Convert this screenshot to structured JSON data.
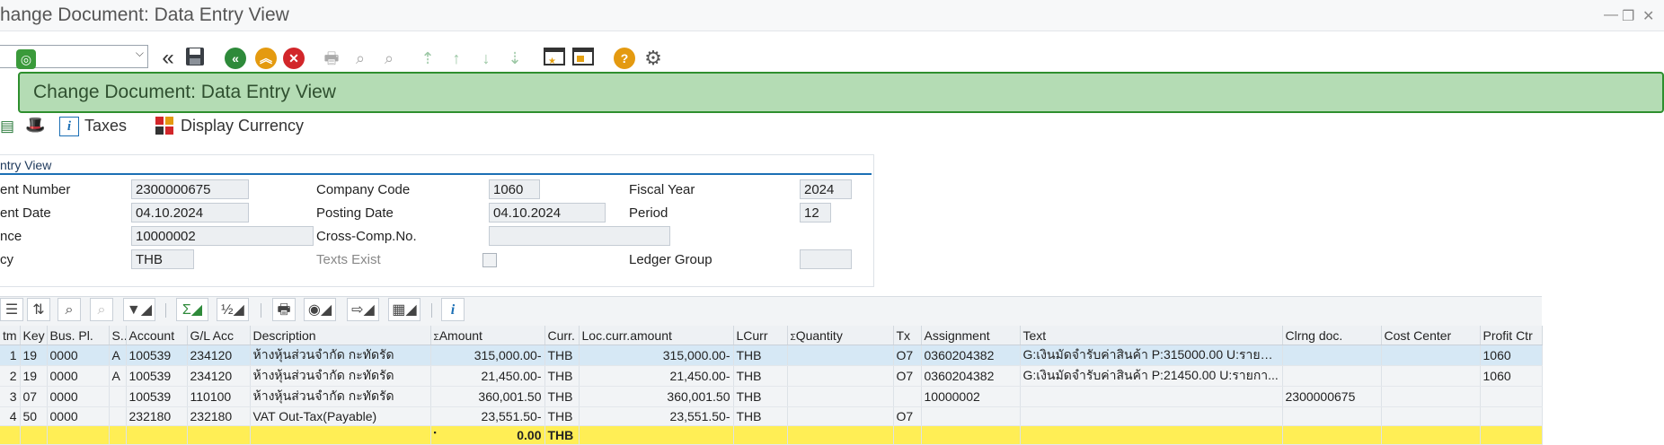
{
  "window": {
    "title": "hange Document: Data Entry View"
  },
  "toolbar": {
    "command_field_value": "",
    "icons": [
      "ok-icon",
      "back-double-icon",
      "save-icon",
      "back-icon",
      "exit-icon",
      "cancel-icon",
      "print-icon",
      "find-icon",
      "find-next-icon",
      "first-page-icon",
      "prev-page-icon",
      "next-page-icon",
      "last-page-icon",
      "create-session-icon",
      "shortcut-icon",
      "help-icon",
      "settings-icon"
    ]
  },
  "banner": {
    "text": "Change Document: Data Entry View"
  },
  "app_toolbar": {
    "taxes_label": "Taxes",
    "display_currency_label": "Display Currency"
  },
  "header": {
    "title": "ntry View",
    "document_number_label": "ent Number",
    "document_number_value": "2300000675",
    "company_code_label": "Company Code",
    "company_code_value": "1060",
    "fiscal_year_label": "Fiscal Year",
    "fiscal_year_value": "2024",
    "document_date_label": "ent Date",
    "document_date_value": "04.10.2024",
    "posting_date_label": "Posting Date",
    "posting_date_value": "04.10.2024",
    "period_label": "Period",
    "period_value": "12",
    "reference_label": "nce",
    "reference_value": "10000002",
    "cross_comp_label": "Cross-Comp.No.",
    "cross_comp_value": "",
    "currency_label": "cy",
    "currency_value": "THB",
    "texts_exist_label": "Texts Exist",
    "ledger_group_label": "Ledger Group",
    "ledger_group_value": ""
  },
  "grid": {
    "columns": [
      "tm",
      "Key",
      "Bus. Pl.",
      "S...",
      "Account",
      "G/L Acc",
      "Description",
      "Amount",
      "Curr.",
      "Loc.curr.amount",
      "LCurr",
      "Quantity",
      "Tx",
      "Assignment",
      "Text",
      "Clrng doc.",
      "Cost Center",
      "Profit Ctr"
    ],
    "sigma": "Σ",
    "rows": [
      {
        "tm": "1",
        "key": "19",
        "bus": "0000",
        "s": "A",
        "account": "100539",
        "gl": "234120",
        "desc": "ห้างหุ้นส่วนจำกัด  กะทัดรัด",
        "amount": "315,000.00-",
        "curr": "THB",
        "loc": "315,000.00-",
        "lcurr": "THB",
        "qty": "",
        "tx": "O7",
        "assign": "0360204382",
        "text": "G:เงินมัดจำรับค่าสินค้า P:315000.00  U:รายกา...",
        "clr": "",
        "cc": "",
        "pc": "1060"
      },
      {
        "tm": "2",
        "key": "19",
        "bus": "0000",
        "s": "A",
        "account": "100539",
        "gl": "234120",
        "desc": "ห้างหุ้นส่วนจำกัด  กะทัดรัด",
        "amount": "21,450.00-",
        "curr": "THB",
        "loc": "21,450.00-",
        "lcurr": "THB",
        "qty": "",
        "tx": "O7",
        "assign": "0360204382",
        "text": "G:เงินมัดจำรับค่าสินค้า P:21450.00  U:รายกา...",
        "clr": "",
        "cc": "",
        "pc": "1060"
      },
      {
        "tm": "3",
        "key": "07",
        "bus": "0000",
        "s": "",
        "account": "100539",
        "gl": "110100",
        "desc": "ห้างหุ้นส่วนจำกัด  กะทัดรัด",
        "amount": "360,001.50",
        "curr": "THB",
        "loc": "360,001.50",
        "lcurr": "THB",
        "qty": "",
        "tx": "",
        "assign": "10000002",
        "text": "",
        "clr": "2300000675",
        "cc": "",
        "pc": ""
      },
      {
        "tm": "4",
        "key": "50",
        "bus": "0000",
        "s": "",
        "account": "232180",
        "gl": "232180",
        "desc": "VAT Out-Tax(Payable)",
        "amount": "23,551.50-",
        "curr": "THB",
        "loc": "23,551.50-",
        "lcurr": "THB",
        "qty": "",
        "tx": "O7",
        "assign": "",
        "text": "",
        "clr": "",
        "cc": "",
        "pc": ""
      }
    ],
    "total": {
      "dot": "▪",
      "amount": "0.00",
      "curr": "THB"
    }
  }
}
